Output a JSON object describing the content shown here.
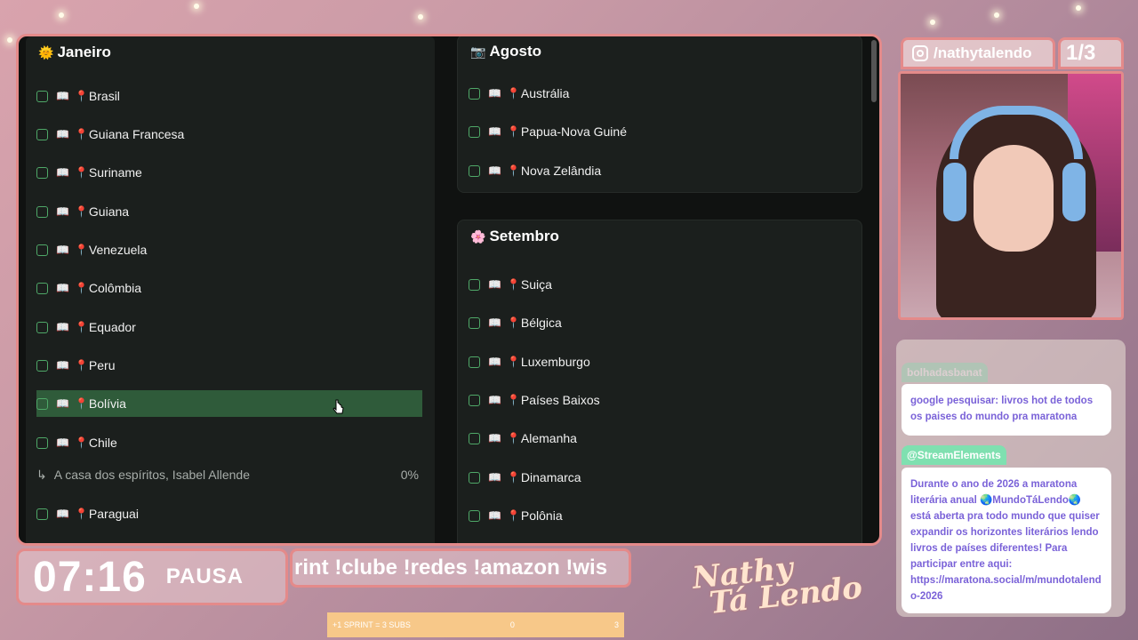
{
  "january": {
    "title": "Janeiro",
    "emoji": "🌞",
    "items": [
      {
        "label": "Brasil"
      },
      {
        "label": "Guiana Francesa"
      },
      {
        "label": "Suriname"
      },
      {
        "label": "Guiana"
      },
      {
        "label": "Venezuela"
      },
      {
        "label": "Colômbia"
      },
      {
        "label": "Equador"
      },
      {
        "label": "Peru"
      },
      {
        "label": "Bolívia"
      },
      {
        "label": "Chile"
      }
    ],
    "subtask": {
      "label": "A casa dos espíritos, Isabel Allende",
      "progress": "0%"
    },
    "after": {
      "label": "Paraguai"
    }
  },
  "august": {
    "title": "Agosto",
    "emoji": "📷",
    "items": [
      {
        "label": "Austrália"
      },
      {
        "label": "Papua-Nova Guiné"
      },
      {
        "label": "Nova Zelândia"
      }
    ]
  },
  "september": {
    "title": "Setembro",
    "emoji": "🌸",
    "items": [
      {
        "label": "Suiça"
      },
      {
        "label": "Bélgica"
      },
      {
        "label": "Luxemburgo"
      },
      {
        "label": "Países Baixos"
      },
      {
        "label": "Alemanha"
      },
      {
        "label": "Dinamarca"
      },
      {
        "label": "Polônia"
      }
    ]
  },
  "overlay": {
    "timer": "07:16",
    "timer_state": "PAUSA",
    "ticker": "rint !clube !redes !amazon !wis",
    "logo_line1": "Nathy",
    "logo_line2": "Tá Lendo",
    "progress_left": "+1 SPRINT = 3 SUBS",
    "progress_mid": "0",
    "progress_right": "3",
    "handle": "/nathytalendo",
    "page": "1/3"
  },
  "chat": {
    "msg1_user": "bolhadasbanat",
    "msg1_text": "google pesquisar: livros hot de todos os paises do mundo pra maratona",
    "msg2_user": "@StreamElements",
    "msg2_text": "Durante o ano de 2026 a maratona literária anual 🌏MundoTáLendo🌏 está aberta pra todo mundo que quiser expandir os horizontes literários lendo livros de países diferentes! Para participar entre aqui: https://maratona.social/m/mundotalendo-2026"
  },
  "colors": {
    "accent": "#e48a8a",
    "checkbox": "#4fa868",
    "highlight": "#2f5b3a",
    "chat_text": "#7a62d8"
  }
}
